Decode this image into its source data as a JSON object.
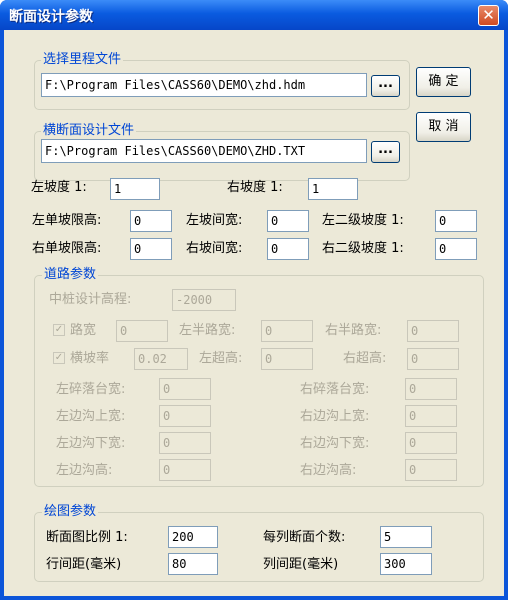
{
  "window": {
    "title": "断面设计参数",
    "close_glyph": "✕"
  },
  "files": {
    "mileage_title": "选择里程文件",
    "mileage_path": "F:\\Program Files\\CASS60\\DEMO\\zhd.hdm",
    "section_title": "横断面设计文件",
    "section_path": "F:\\Program Files\\CASS60\\DEMO\\ZHD.TXT",
    "browse_label": "..."
  },
  "buttons": {
    "ok": "确 定",
    "cancel": "取 消"
  },
  "slopes": {
    "left_label": "左坡度  1:",
    "left_value": "1",
    "right_label": "右坡度  1:",
    "right_value": "1",
    "left_single_limit_label": "左单坡限高:",
    "left_single_limit_value": "0",
    "left_slope_width_label": "左坡间宽:",
    "left_slope_width_value": "0",
    "left_second_label": "左二级坡度  1:",
    "left_second_value": "0",
    "right_single_limit_label": "右单坡限高:",
    "right_single_limit_value": "0",
    "right_slope_width_label": "右坡间宽:",
    "right_slope_width_value": "0",
    "right_second_label": "右二级坡度  1:",
    "right_second_value": "0"
  },
  "road": {
    "title": "道路参数",
    "center_design_label": "中桩设计高程:",
    "center_design_value": "-2000",
    "road_width_label": "路宽",
    "road_width_value": "0",
    "left_half_label": "左半路宽:",
    "left_half_value": "0",
    "right_half_label": "右半路宽:",
    "right_half_value": "0",
    "cross_slope_label": "横坡率",
    "cross_slope_value": "0.02",
    "left_super_label": "左超高:",
    "left_super_value": "0",
    "right_super_label": "右超高:",
    "right_super_value": "0",
    "left_platform_label": "左碎落台宽:",
    "left_platform_value": "0",
    "right_platform_label": "右碎落台宽:",
    "right_platform_value": "0",
    "left_ditch_top_label": "左边沟上宽:",
    "left_ditch_top_value": "0",
    "right_ditch_top_label": "右边沟上宽:",
    "right_ditch_top_value": "0",
    "left_ditch_bottom_label": "左边沟下宽:",
    "left_ditch_bottom_value": "0",
    "right_ditch_bottom_label": "右边沟下宽:",
    "right_ditch_bottom_value": "0",
    "left_ditch_height_label": "左边沟高:",
    "left_ditch_height_value": "0",
    "right_ditch_height_label": "右边沟高:",
    "right_ditch_height_value": "0",
    "check_glyph": "✓"
  },
  "plot": {
    "title": "绘图参数",
    "scale_label": "断面图比例   1:",
    "scale_value": "200",
    "per_column_label": "每列断面个数:",
    "per_column_value": "5",
    "row_spacing_label": "行间距(毫米)",
    "row_spacing_value": "80",
    "col_spacing_label": "列间距(毫米)",
    "col_spacing_value": "300"
  }
}
